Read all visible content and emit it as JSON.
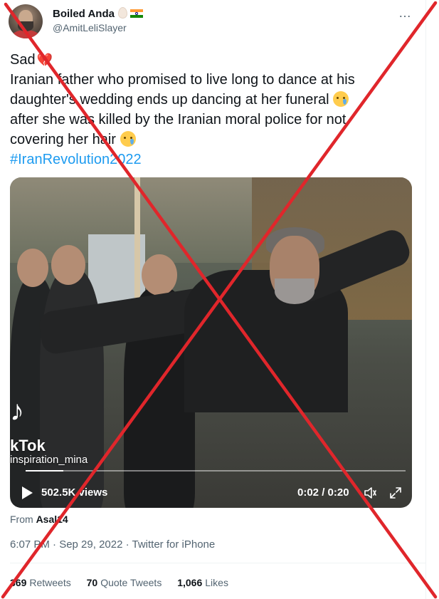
{
  "author": {
    "display_name": "Boiled Anda",
    "handle": "@AmitLeliSlayer",
    "avatar_icon": "avatar-man-beard"
  },
  "more_icon": "…",
  "tweet": {
    "line1": "Sad",
    "line2": "Iranian father who promised to live long to dance at his",
    "line3": "daughter's wedding ends up dancing at her funeral",
    "line4": "after she was killed by the Iranian moral police for not",
    "line5": "covering her hair",
    "hashtag": "#IranRevolution2022",
    "broken_heart": "💔"
  },
  "video": {
    "watermark_logo": "♪",
    "watermark_brand": "kTok",
    "watermark_user": "inspiration_mina",
    "views": "502.5K views",
    "time": "0:02 / 0:20",
    "progress": 0.1
  },
  "from": {
    "label": "From",
    "source": "Asal14"
  },
  "meta": {
    "timestamp": "6:07 PM · Sep 29, 2022 · Twitter for iPhone"
  },
  "stats": {
    "retweets_count": "369",
    "retweets_label": "Retweets",
    "quotes_count": "70",
    "quotes_label": "Quote Tweets",
    "likes_count": "1,066",
    "likes_label": "Likes"
  },
  "colors": {
    "link": "#1d9bf0",
    "secondary_text": "#536471",
    "overlay_cross": "#e0262b"
  }
}
